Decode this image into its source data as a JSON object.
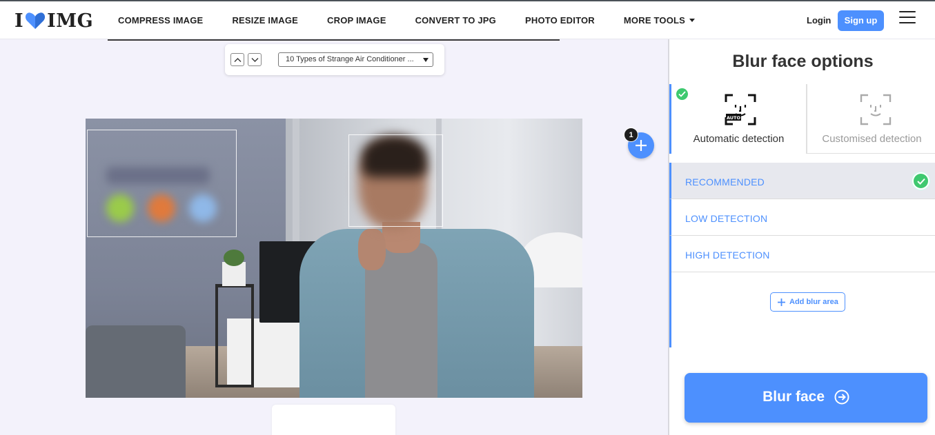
{
  "brand": {
    "logo_left": "I",
    "logo_right": "IMG"
  },
  "nav": {
    "items": [
      {
        "label": "COMPRESS IMAGE"
      },
      {
        "label": "RESIZE IMAGE"
      },
      {
        "label": "CROP IMAGE"
      },
      {
        "label": "CONVERT TO JPG"
      },
      {
        "label": "PHOTO EDITOR"
      },
      {
        "label": "MORE TOOLS"
      }
    ],
    "login": "Login",
    "signup": "Sign up"
  },
  "workspace": {
    "file_select": "10 Types of Strange Air Conditioner ...",
    "face_count": "1"
  },
  "sidebar": {
    "title": "Blur face options",
    "tabs": [
      {
        "label": "Automatic detection",
        "selected": true,
        "icon": "auto-face-scan-icon",
        "icon_text": "AUTO"
      },
      {
        "label": "Customised detection",
        "selected": false,
        "icon": "face-scan-icon"
      }
    ],
    "options": [
      {
        "label": "RECOMMENDED",
        "selected": true
      },
      {
        "label": "LOW DETECTION",
        "selected": false
      },
      {
        "label": "HIGH DETECTION",
        "selected": false
      }
    ],
    "add_area": "Add blur area",
    "action": "Blur face"
  },
  "colors": {
    "accent": "#4d90fe",
    "success": "#3ec96f"
  }
}
